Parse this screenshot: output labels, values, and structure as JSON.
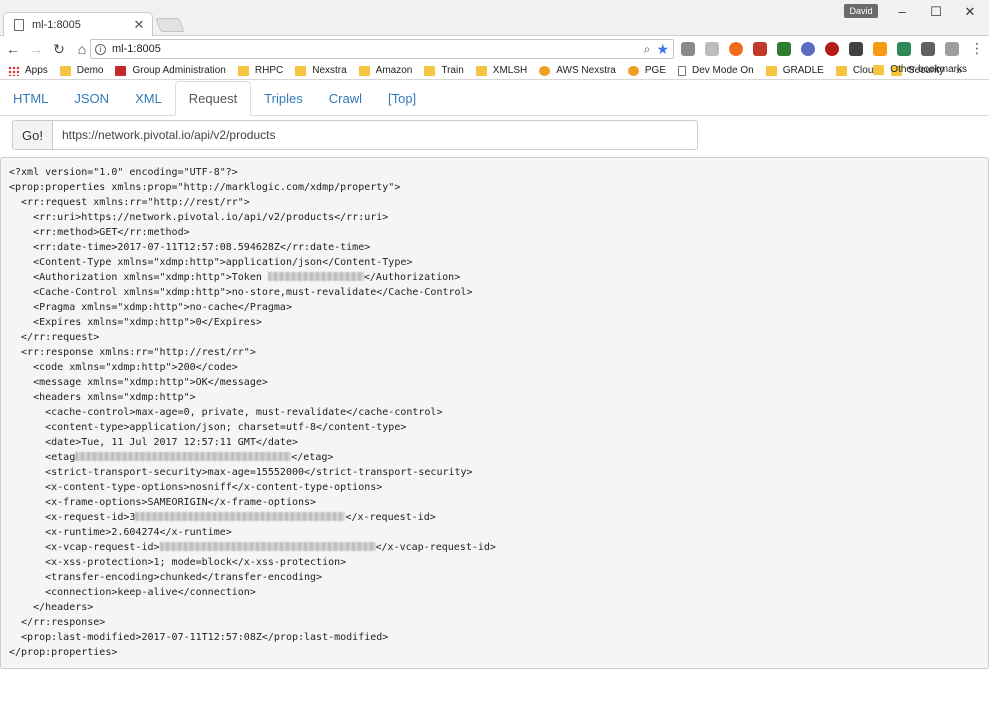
{
  "browser": {
    "tab_title": "ml-1:8005",
    "profile": "David",
    "address": "ml-1:8005"
  },
  "bookmarks": [
    {
      "label": "Apps",
      "icon": "apps-grid-icon"
    },
    {
      "label": "Demo",
      "icon": "folder-icon"
    },
    {
      "label": "Group Administration",
      "icon": "group-admin-icon"
    },
    {
      "label": "RHPC",
      "icon": "folder-icon"
    },
    {
      "label": "Nexstra",
      "icon": "folder-icon"
    },
    {
      "label": "Amazon",
      "icon": "folder-icon"
    },
    {
      "label": "Train",
      "icon": "folder-icon"
    },
    {
      "label": "XMLSH",
      "icon": "folder-icon"
    },
    {
      "label": "AWS Nexstra",
      "icon": "aws-icon"
    },
    {
      "label": "PGE",
      "icon": "pge-icon"
    },
    {
      "label": "Dev Mode On",
      "icon": "page-icon"
    },
    {
      "label": "GRADLE",
      "icon": "folder-icon"
    },
    {
      "label": "Cloud",
      "icon": "folder-icon"
    },
    {
      "label": "Security",
      "icon": "folder-icon"
    }
  ],
  "bookmarks_more": "»",
  "other_bookmarks": "Other bookmarks",
  "nav_tabs": [
    {
      "label": "HTML",
      "active": false
    },
    {
      "label": "JSON",
      "active": false
    },
    {
      "label": "XML",
      "active": false
    },
    {
      "label": "Request",
      "active": true
    },
    {
      "label": "Triples",
      "active": false
    },
    {
      "label": "Crawl",
      "active": false
    },
    {
      "label": "[Top]",
      "active": false
    }
  ],
  "request_form": {
    "go_label": "Go!",
    "url_value": "https://network.pivotal.io/api/v2/products"
  },
  "xml_lines": [
    {
      "indent": 0,
      "text": "<?xml version=\"1.0\" encoding=\"UTF-8\"?>"
    },
    {
      "indent": 0,
      "text": "<prop:properties xmlns:prop=\"http://marklogic.com/xdmp/property\">"
    },
    {
      "indent": 1,
      "text": "<rr:request xmlns:rr=\"http://rest/rr\">"
    },
    {
      "indent": 2,
      "text": "<rr:uri>https://network.pivotal.io/api/v2/products</rr:uri>"
    },
    {
      "indent": 2,
      "text": "<rr:method>GET</rr:method>"
    },
    {
      "indent": 2,
      "text": "<rr:date-time>2017-07-11T12:57:08.594628Z</rr:date-time>"
    },
    {
      "indent": 2,
      "text": "<Content-Type xmlns=\"xdmp:http\">application/json</Content-Type>"
    },
    {
      "indent": 2,
      "text": "<Authorization xmlns=\"xdmp:http\">Token ",
      "redacted": 16,
      "after": "</Authorization>"
    },
    {
      "indent": 2,
      "text": "<Cache-Control xmlns=\"xdmp:http\">no-store,must-revalidate</Cache-Control>"
    },
    {
      "indent": 2,
      "text": "<Pragma xmlns=\"xdmp:http\">no-cache</Pragma>"
    },
    {
      "indent": 2,
      "text": "<Expires xmlns=\"xdmp:http\">0</Expires>"
    },
    {
      "indent": 1,
      "text": "</rr:request>"
    },
    {
      "indent": 1,
      "text": "<rr:response xmlns:rr=\"http://rest/rr\">"
    },
    {
      "indent": 2,
      "text": "<code xmlns=\"xdmp:http\">200</code>"
    },
    {
      "indent": 2,
      "text": "<message xmlns=\"xdmp:http\">OK</message>"
    },
    {
      "indent": 2,
      "text": "<headers xmlns=\"xdmp:http\">"
    },
    {
      "indent": 3,
      "text": "<cache-control>max-age=0, private, must-revalidate</cache-control>"
    },
    {
      "indent": 3,
      "text": "<content-type>application/json; charset=utf-8</content-type>"
    },
    {
      "indent": 3,
      "text": "<date>Tue, 11 Jul 2017 12:57:11 GMT</date>"
    },
    {
      "indent": 3,
      "text": "<etag",
      "redacted": 36,
      "after": "</etag>"
    },
    {
      "indent": 3,
      "text": "<strict-transport-security>max-age=15552000</strict-transport-security>"
    },
    {
      "indent": 3,
      "text": "<x-content-type-options>nosniff</x-content-type-options>"
    },
    {
      "indent": 3,
      "text": "<x-frame-options>SAMEORIGIN</x-frame-options>"
    },
    {
      "indent": 3,
      "text": "<x-request-id>3",
      "redacted": 35,
      "after": "</x-request-id>"
    },
    {
      "indent": 3,
      "text": "<x-runtime>2.604274</x-runtime>"
    },
    {
      "indent": 3,
      "text": "<x-vcap-request-id>",
      "redacted": 36,
      "after": "</x-vcap-request-id>"
    },
    {
      "indent": 3,
      "text": "<x-xss-protection>1; mode=block</x-xss-protection>"
    },
    {
      "indent": 3,
      "text": "<transfer-encoding>chunked</transfer-encoding>"
    },
    {
      "indent": 3,
      "text": "<connection>keep-alive</connection>"
    },
    {
      "indent": 2,
      "text": "</headers>"
    },
    {
      "indent": 1,
      "text": "</rr:response>"
    },
    {
      "indent": 1,
      "text": "<prop:last-modified>2017-07-11T12:57:08Z</prop:last-modified>"
    },
    {
      "indent": 0,
      "text": "</prop:properties>"
    }
  ],
  "extension_colors": [
    "#8a8a8a",
    "#bdbdbd",
    "#f26b1d",
    "#c0392b",
    "#2e7d32",
    "#5c6bc0",
    "#b71c1c",
    "#424242",
    "#f39c12",
    "#2e8b57",
    "#616161",
    "#9e9e9e"
  ]
}
